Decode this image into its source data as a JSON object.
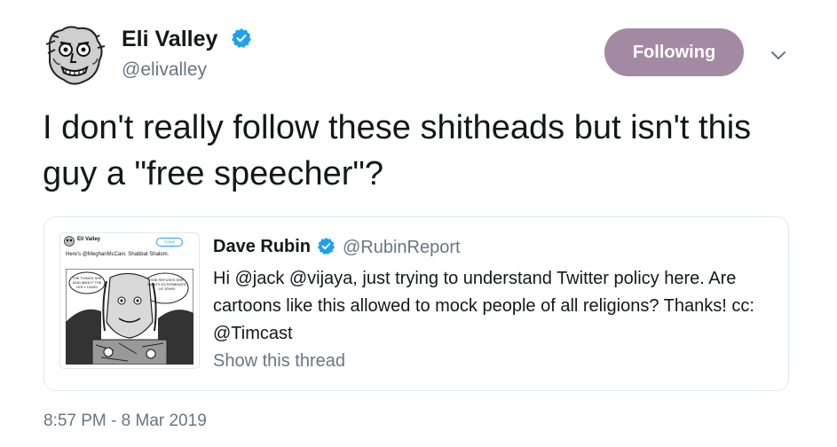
{
  "author": {
    "name": "Eli Valley",
    "handle": "@elivalley",
    "verified": true
  },
  "follow_button": {
    "label": "Following",
    "color": "#a489a3"
  },
  "tweet": {
    "text": "I don't really follow these shitheads but isn't this guy a \"free speecher\"?",
    "timestamp": "8:57 PM - 8 Mar 2019"
  },
  "quoted_tweet": {
    "name": "Dave Rubin",
    "handle": "@RubinReport",
    "verified": true,
    "text": "Hi @jack @vijaya, just trying to understand Twitter policy here. Are cartoons like this allowed to mock people of all religions? Thanks! cc: @Timcast",
    "show_thread": "Show this thread",
    "thumbnail": {
      "name": "Eli Valley",
      "follow": "Follow",
      "text": "Here's @MeghanMcCain. Shabbat Shalom.",
      "bubble_left": "THE THINGS SHE SAID ABOUT THE HOLY LAND!",
      "bubble_right": "SHE REFUSES SHE WANTS EXTERMINATE US JEWS!"
    }
  },
  "icons": {
    "verified": "verified-badge-icon",
    "chevron": "chevron-down-icon"
  },
  "colors": {
    "verified_blue": "#1da1f2",
    "secondary_text": "#657786"
  }
}
